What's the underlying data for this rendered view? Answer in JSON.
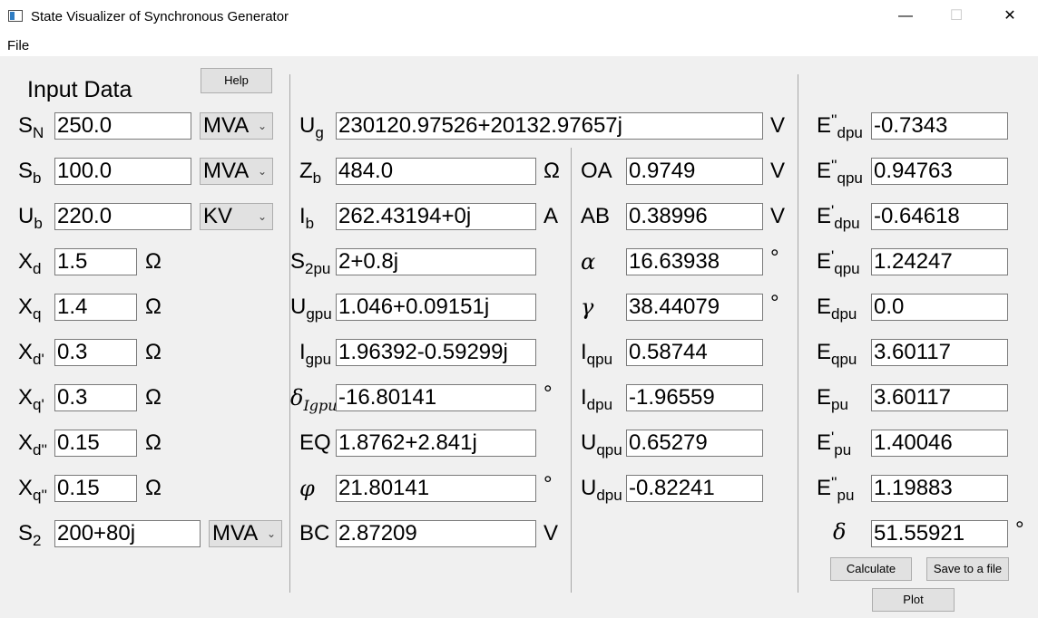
{
  "window": {
    "title": "State Visualizer of Synchronous Generator",
    "minimize": "—",
    "maximize": "☐",
    "close": "✕"
  },
  "menu": {
    "file": "File"
  },
  "input": {
    "heading": "Input Data",
    "help": "Help",
    "SN": {
      "main": "S",
      "sub": "N",
      "value": "250.0",
      "unit": "MVA"
    },
    "Sb": {
      "main": "S",
      "sub": "b",
      "value": "100.0",
      "unit": "MVA"
    },
    "Ub": {
      "main": "U",
      "sub": "b",
      "value": "220.0",
      "unit": "KV"
    },
    "Xd": {
      "main": "X",
      "sub": "d",
      "value": "1.5",
      "unit": "Ω"
    },
    "Xq": {
      "main": "X",
      "sub": "q",
      "value": "1.4",
      "unit": "Ω"
    },
    "Xd1": {
      "main": "X",
      "sub": "d'",
      "value": "0.3",
      "unit": "Ω"
    },
    "Xq1": {
      "main": "X",
      "sub": "q'",
      "value": "0.3",
      "unit": "Ω"
    },
    "Xd2": {
      "main": "X",
      "sub": "d''",
      "value": "0.15",
      "unit": "Ω"
    },
    "Xq2": {
      "main": "X",
      "sub": "q''",
      "value": "0.15",
      "unit": "Ω"
    },
    "S2": {
      "main": "S",
      "sub": "2",
      "value": "200+80j",
      "unit": "MVA"
    }
  },
  "mid": {
    "Ug": {
      "main": "U",
      "sub": "g",
      "value": "230120.97526+20132.97657j",
      "unit": "V"
    },
    "Zb": {
      "main": "Z",
      "sub": "b",
      "value": "484.0",
      "unit": "Ω"
    },
    "Ib": {
      "main": "I",
      "sub": "b",
      "value": "262.43194+0j",
      "unit": "A"
    },
    "S2pu": {
      "main": "S",
      "sub": "2pu",
      "value": "2+0.8j"
    },
    "Ugpu": {
      "main": "U",
      "sub": "gpu",
      "value": "1.046+0.09151j"
    },
    "Igpu": {
      "main": "I",
      "sub": "gpu",
      "value": "1.96392-0.59299j"
    },
    "deltaIgpu": {
      "main": "δ",
      "sub": "Igpu",
      "value": "-16.80141",
      "unit": "°"
    },
    "EQ": {
      "main": "EQ",
      "value": "1.8762+2.841j"
    },
    "phi": {
      "main": "φ",
      "value": "21.80141",
      "unit": "°"
    },
    "BC": {
      "main": "BC",
      "value": "2.87209",
      "unit": "V"
    }
  },
  "right": {
    "OA": {
      "main": "OA",
      "value": "0.9749",
      "unit": "V"
    },
    "AB": {
      "main": "AB",
      "value": "0.38996",
      "unit": "V"
    },
    "alpha": {
      "main": "α",
      "value": "16.63938",
      "unit": "°"
    },
    "gamma": {
      "main": "γ",
      "value": "38.44079",
      "unit": "°"
    },
    "Iqpu": {
      "main": "I",
      "sub": "qpu",
      "value": "0.58744"
    },
    "Idpu": {
      "main": "I",
      "sub": "dpu",
      "value": "-1.96559"
    },
    "Uqpu": {
      "main": "U",
      "sub": "qpu",
      "value": "0.65279"
    },
    "Udpu": {
      "main": "U",
      "sub": "dpu",
      "value": "-0.82241"
    }
  },
  "far": {
    "Edpu2": {
      "main": "E",
      "sup": "''",
      "sub": "dpu",
      "value": "-0.7343"
    },
    "Eqpu2": {
      "main": "E",
      "sup": "''",
      "sub": "qpu",
      "value": "0.94763"
    },
    "Edpu1": {
      "main": "E",
      "sup": "'",
      "sub": "dpu",
      "value": "-0.64618"
    },
    "Eqpu1": {
      "main": "E",
      "sup": "'",
      "sub": "qpu",
      "value": "1.24247"
    },
    "Edpu": {
      "main": "E",
      "sub": "dpu",
      "value": "0.0"
    },
    "Eqpu": {
      "main": "E",
      "sub": "qpu",
      "value": "3.60117"
    },
    "Epu": {
      "main": "E",
      "sub": "pu",
      "value": "3.60117"
    },
    "Epu1": {
      "main": "E",
      "sup": "'",
      "sub": "pu",
      "value": "1.40046"
    },
    "Epu2": {
      "main": "E",
      "sup": "''",
      "sub": "pu",
      "value": "1.19883"
    },
    "delta": {
      "main": "δ",
      "value": "51.55921",
      "unit": "°"
    }
  },
  "buttons": {
    "calculate": "Calculate",
    "save": "Save to a file",
    "plot": "Plot"
  }
}
